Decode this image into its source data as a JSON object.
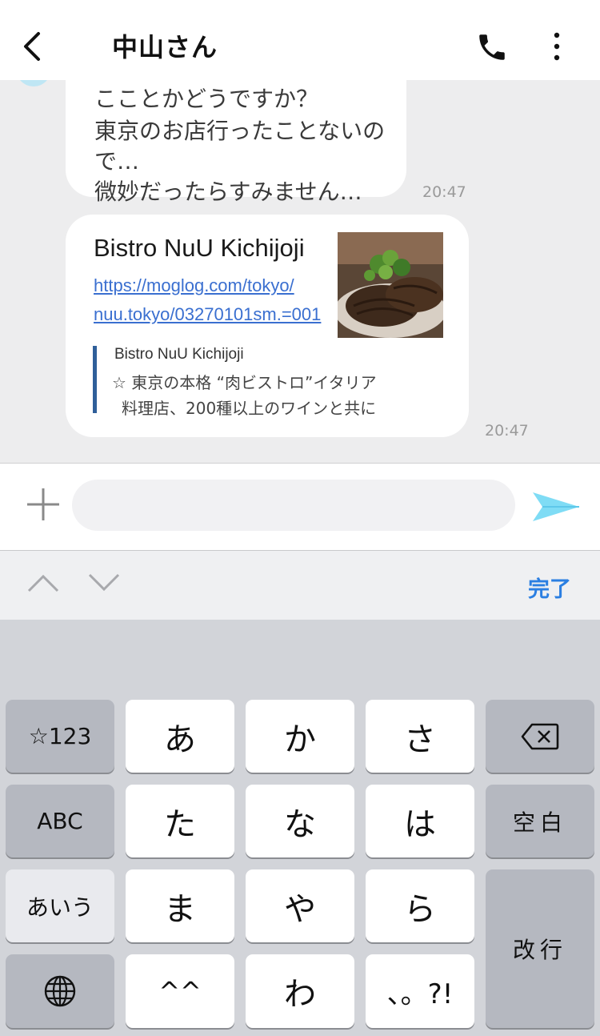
{
  "header": {
    "contact_name": "中山さん",
    "back_icon": "back-chevron-icon",
    "call_icon": "phone-icon",
    "menu_icon": "more-vertical-icon"
  },
  "messages": [
    {
      "lines": [
        "こことかどうですか？",
        "東京のお店行ったことないの",
        "で…",
        "微妙だったらすみません…"
      ],
      "time": "20:47"
    },
    {
      "link_title": "Bistro NuU Kichijoji",
      "url_lines": [
        "https://moglog.com/tokyo/",
        "nuu.tokyo/03270101sm.=001"
      ],
      "preview_site": "Bistro NuU Kichijoji",
      "preview_lines": [
        "☆ 東京の本格 “肉ビストロ”イタリア",
        "料理店、200種以上のワインと共に"
      ],
      "time": "20:47"
    }
  ],
  "input": {
    "placeholder": "",
    "plus_icon": "plus-icon",
    "send_icon": "send-icon"
  },
  "kb_toolbar": {
    "done": "完了"
  },
  "keyboard": {
    "num_key": "☆123",
    "row1": [
      "あ",
      "か",
      "さ"
    ],
    "abc_key": "ABC",
    "row2": [
      "た",
      "な",
      "は"
    ],
    "space_key": "空白",
    "kana_key": "あいう",
    "row3": [
      "ま",
      "や",
      "ら"
    ],
    "enter_key": "改行",
    "emoticon_key": "^^",
    "wa_key": "わ",
    "punct_key": "、。?!",
    "globe_icon": "globe-icon",
    "delete_icon": "delete-backspace-icon"
  },
  "colors": {
    "accent": "#2b7fe2",
    "send": "#7fdcf5",
    "link": "#3a6fd0"
  }
}
